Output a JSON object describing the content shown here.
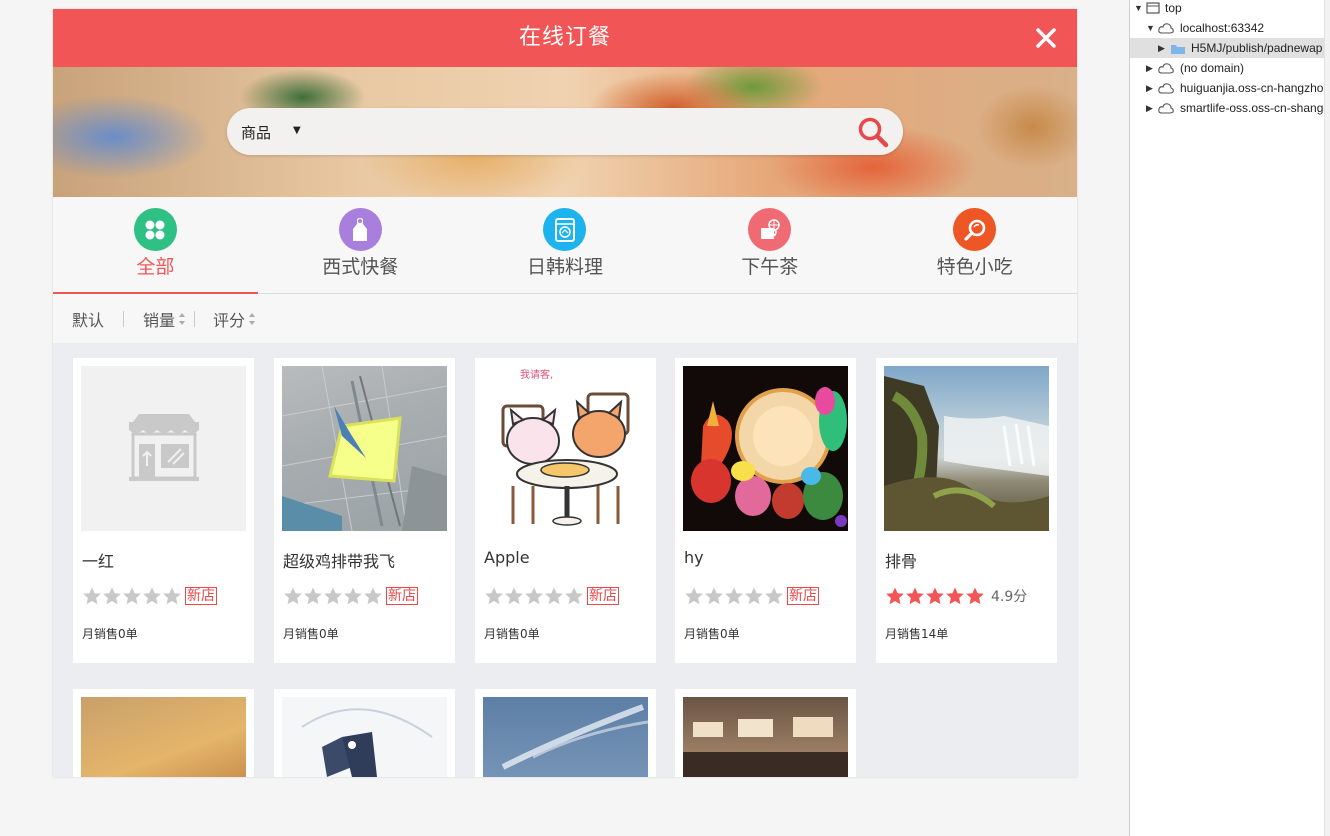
{
  "header": {
    "title": "在线订餐",
    "close_icon": "close-icon"
  },
  "search": {
    "category": "商品",
    "value": "",
    "placeholder": ""
  },
  "categories": [
    {
      "label": "全部",
      "icon": "grid-icon",
      "color": "#2ec085",
      "active": true
    },
    {
      "label": "西式快餐",
      "icon": "chef-apron-icon",
      "color": "#a97fde",
      "active": false
    },
    {
      "label": "日韩料理",
      "icon": "washer-icon",
      "color": "#1cb3ee",
      "active": false
    },
    {
      "label": "下午茶",
      "icon": "coffee-globe-icon",
      "color": "#f06a74",
      "active": false
    },
    {
      "label": "特色小吃",
      "icon": "magnifier-icon",
      "color": "#ef5625",
      "active": false
    }
  ],
  "sort": {
    "default": "默认",
    "sales": "销量",
    "rating": "评分"
  },
  "shops": [
    {
      "name": "一红",
      "rating": 0,
      "badge": "新店",
      "score": "",
      "sales": "月销售0单",
      "image": "shop-placeholder"
    },
    {
      "name": "超级鸡排带我飞",
      "rating": 0,
      "badge": "新店",
      "score": "",
      "sales": "月销售0单",
      "image": "ceiling-photo"
    },
    {
      "name": "Apple",
      "rating": 0,
      "badge": "新店",
      "score": "",
      "sales": "月销售0单",
      "image": "cats-cartoon"
    },
    {
      "name": "hy",
      "rating": 0,
      "badge": "新店",
      "score": "",
      "sales": "月销售0单",
      "image": "lanterns-photo"
    },
    {
      "name": "排骨",
      "rating": 5,
      "badge": "",
      "score": "4.9分",
      "sales": "月销售14单",
      "image": "waterfall-photo"
    }
  ],
  "shops_row2": [
    {
      "image": "food-photo"
    },
    {
      "image": "umbrella-girl"
    },
    {
      "image": "sky-photo"
    },
    {
      "image": "bakery-photo"
    }
  ],
  "colors": {
    "accent": "#f25556",
    "star_on": "#f25556",
    "star_off": "#c8c8c8"
  },
  "devtools": {
    "items": [
      "top",
      "localhost:63342",
      "H5MJ/publish/padnewap",
      "(no domain)",
      "huiguanjia.oss-cn-hangzhou",
      "smartlife-oss.oss-cn-shangh"
    ]
  }
}
